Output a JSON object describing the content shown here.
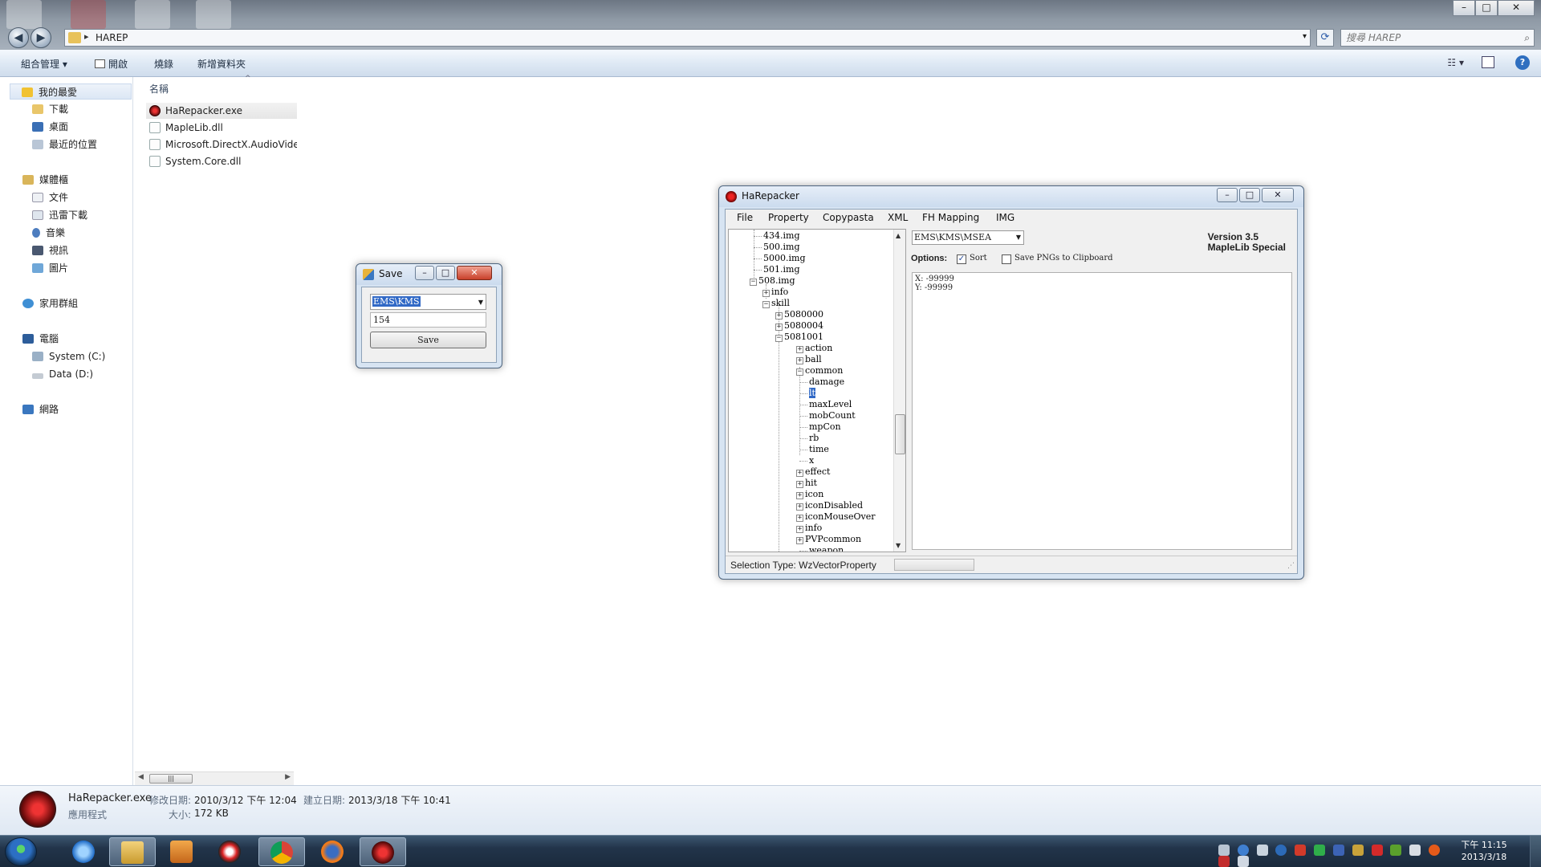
{
  "explorer": {
    "address_crumb": "HAREP",
    "search_placeholder": "搜尋 HAREP",
    "commands": {
      "organize": "組合管理 ▾",
      "open": "開啟",
      "burn": "燒錄",
      "new_folder": "新增資料夾"
    },
    "nav": {
      "favorites_header": "我的最愛",
      "favorites": [
        "下載",
        "桌面",
        "最近的位置"
      ],
      "libraries_header": "媒體櫃",
      "libraries": [
        "文件",
        "迅雷下載",
        "音樂",
        "視訊",
        "圖片"
      ],
      "homegroup": "家用群組",
      "computer_header": "電腦",
      "drives": [
        "System (C:)",
        "Data (D:)"
      ],
      "network": "網路"
    },
    "column_header": "名稱",
    "files": [
      "HaRepacker.exe",
      "MapleLib.dll",
      "Microsoft.DirectX.AudioVideo",
      "System.Core.dll"
    ],
    "details": {
      "name": "HaRepacker.exe",
      "type": "應用程式",
      "modified_label": "修改日期:",
      "modified": "2010/3/12 下午 12:04",
      "created_label": "建立日期:",
      "created": "2013/3/18 下午 10:41",
      "size_label": "大小:",
      "size": "172 KB"
    }
  },
  "harepacker": {
    "title": "HaRepacker",
    "menu": [
      "File",
      "Property",
      "Copypasta",
      "XML",
      "FH Mapping",
      "IMG"
    ],
    "tree": {
      "imgs": [
        "434.img",
        "500.img",
        "5000.img",
        "501.img",
        "508.img"
      ],
      "img508_children": [
        "info",
        "skill"
      ],
      "skills": [
        "5080000",
        "5080004",
        "5081001"
      ],
      "skill_children_before": [
        "action",
        "ball",
        "common"
      ],
      "common_children": [
        "damage",
        "lt",
        "maxLevel",
        "mobCount",
        "mpCon",
        "rb",
        "time",
        "x"
      ],
      "skill_children_after": [
        "effect",
        "hit",
        "icon",
        "iconDisabled",
        "iconMouseOver",
        "info",
        "PVPcommon",
        "weapon"
      ]
    },
    "region": "EMS\\KMS\\MSEA",
    "version_line1": "Version 3.5",
    "version_line2": "MapleLib Special",
    "options_label": "Options:",
    "sort_label": "Sort",
    "save_png_label": "Save PNGs to Clipboard",
    "vector_x": "X: -99999",
    "vector_y": "Y: -99999",
    "status": "Selection Type: WzVectorProperty"
  },
  "save_dialog": {
    "title": "Save",
    "combo_value": "EMS\\KMS",
    "number_value": "154",
    "button_label": "Save"
  },
  "taskbar": {
    "time": "下午 11:15",
    "date": "2013/3/18"
  }
}
